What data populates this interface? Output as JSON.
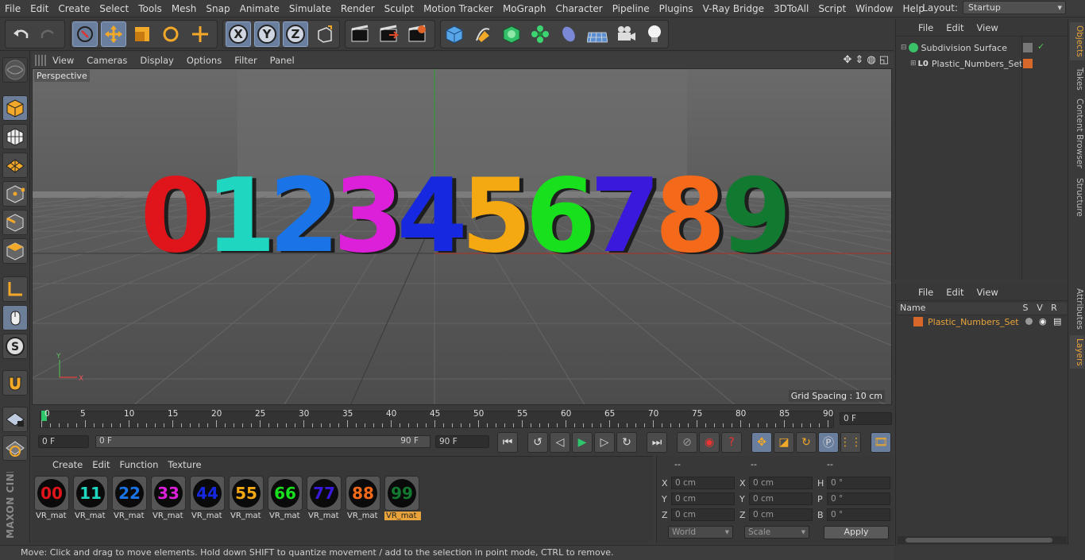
{
  "menubar": {
    "items": [
      "File",
      "Edit",
      "Create",
      "Select",
      "Tools",
      "Mesh",
      "Snap",
      "Animate",
      "Simulate",
      "Render",
      "Sculpt",
      "Motion Tracker",
      "MoGraph",
      "Character",
      "Pipeline",
      "Plugins",
      "V-Ray Bridge",
      "3DToAll",
      "Script",
      "Window",
      "Help"
    ],
    "layout_label": "Layout:",
    "layout_value": "Startup"
  },
  "viewport": {
    "menu": [
      "View",
      "Cameras",
      "Display",
      "Options",
      "Filter",
      "Panel"
    ],
    "label": "Perspective",
    "grid_spacing": "Grid Spacing : 10 cm",
    "digits": [
      "0",
      "1",
      "2",
      "3",
      "4",
      "5",
      "6",
      "7",
      "8",
      "9"
    ],
    "digit_colors": [
      "#e0151b",
      "#1fd6c0",
      "#1a74e8",
      "#dc1fd8",
      "#1628e0",
      "#f4a812",
      "#18e01c",
      "#3a18dc",
      "#f46a1a",
      "#127a30"
    ]
  },
  "timeline": {
    "ticks": [
      "0",
      "5",
      "10",
      "15",
      "20",
      "25",
      "30",
      "35",
      "40",
      "45",
      "50",
      "55",
      "60",
      "65",
      "70",
      "75",
      "80",
      "85",
      "90"
    ],
    "current_frame": "0 F"
  },
  "transport": {
    "start": "0 F",
    "range_start": "0 F",
    "range_end": "90 F",
    "end": "90 F"
  },
  "materials": {
    "menu": [
      "Create",
      "Edit",
      "Function",
      "Texture"
    ],
    "items": [
      {
        "label": "VR_mat",
        "digits": "00",
        "color": "#e0151b"
      },
      {
        "label": "VR_mat",
        "digits": "11",
        "color": "#1fd6c0"
      },
      {
        "label": "VR_mat",
        "digits": "22",
        "color": "#1a74e8"
      },
      {
        "label": "VR_mat",
        "digits": "33",
        "color": "#dc1fd8"
      },
      {
        "label": "VR_mat",
        "digits": "44",
        "color": "#1628e0"
      },
      {
        "label": "VR_mat",
        "digits": "55",
        "color": "#f4a812"
      },
      {
        "label": "VR_mat",
        "digits": "66",
        "color": "#18e01c"
      },
      {
        "label": "VR_mat",
        "digits": "77",
        "color": "#3a18dc"
      },
      {
        "label": "VR_mat",
        "digits": "88",
        "color": "#f46a1a"
      },
      {
        "label": "VR_mat",
        "digits": "99",
        "color": "#127a30"
      }
    ]
  },
  "coords": {
    "headers": [
      "--",
      "--",
      "--"
    ],
    "rows": [
      {
        "a": "X",
        "av": "0 cm",
        "b": "X",
        "bv": "0 cm",
        "c": "H",
        "cv": "0 °"
      },
      {
        "a": "Y",
        "av": "0 cm",
        "b": "Y",
        "bv": "0 cm",
        "c": "P",
        "cv": "0 °"
      },
      {
        "a": "Z",
        "av": "0 cm",
        "b": "Z",
        "bv": "0 cm",
        "c": "B",
        "cv": "0 °"
      }
    ],
    "mode1": "World",
    "mode2": "Scale",
    "apply": "Apply"
  },
  "objects": {
    "menu": [
      "File",
      "Edit",
      "View"
    ],
    "items": [
      "Subdivision Surface",
      "Plastic_Numbers_Set"
    ]
  },
  "layers": {
    "menu": [
      "File",
      "Edit",
      "View"
    ],
    "col_name": "Name",
    "col_s": "S",
    "col_v": "V",
    "col_r": "R",
    "item": "Plastic_Numbers_Set"
  },
  "sidetabs": [
    "Objects",
    "Takes",
    "Content Browser",
    "Structure",
    "Attributes",
    "Layers"
  ],
  "brand": "MAXON CINEMA 4D",
  "status": "Move: Click and drag to move elements. Hold down SHIFT to quantize movement / add to the selection in point mode, CTRL to remove."
}
